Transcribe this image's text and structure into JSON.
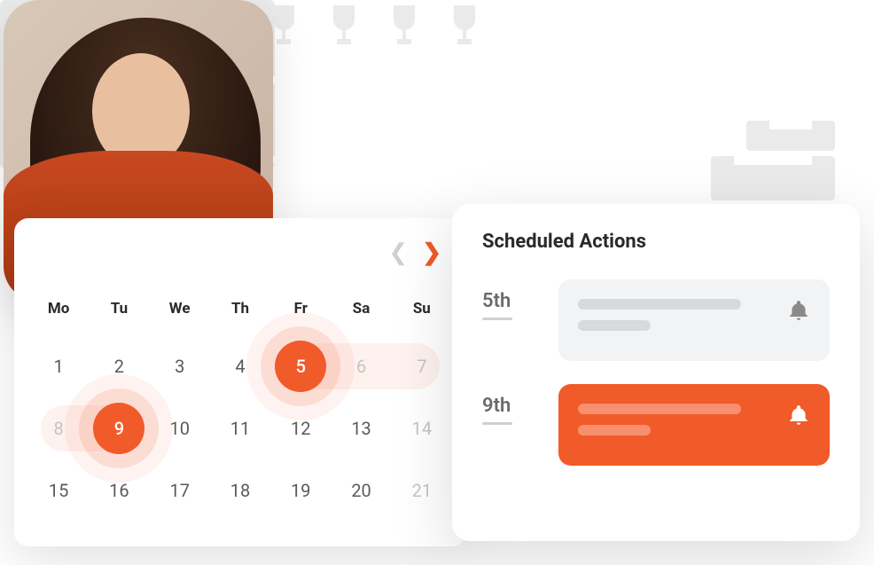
{
  "calendar": {
    "day_headers": [
      "Mo",
      "Tu",
      "We",
      "Th",
      "Fr",
      "Sa",
      "Su"
    ],
    "days": [
      {
        "n": "1"
      },
      {
        "n": "2"
      },
      {
        "n": "3"
      },
      {
        "n": "4"
      },
      {
        "n": "5",
        "highlighted": true,
        "range": "start"
      },
      {
        "n": "6",
        "dimmed": true,
        "range": "mid"
      },
      {
        "n": "7",
        "dimmed": true,
        "range": "end"
      },
      {
        "n": "8",
        "dimmed": true,
        "range": "start"
      },
      {
        "n": "9",
        "highlighted": true,
        "range": "end"
      },
      {
        "n": "10"
      },
      {
        "n": "11"
      },
      {
        "n": "12"
      },
      {
        "n": "13"
      },
      {
        "n": "14",
        "dimmed": true
      },
      {
        "n": "15"
      },
      {
        "n": "16"
      },
      {
        "n": "17"
      },
      {
        "n": "18"
      },
      {
        "n": "19"
      },
      {
        "n": "20"
      },
      {
        "n": "21",
        "dimmed": true
      }
    ]
  },
  "actions": {
    "title": "Scheduled Actions",
    "items": [
      {
        "date": "5th",
        "style": "gray"
      },
      {
        "date": "9th",
        "style": "orange"
      }
    ]
  },
  "colors": {
    "accent": "#f15a29"
  }
}
